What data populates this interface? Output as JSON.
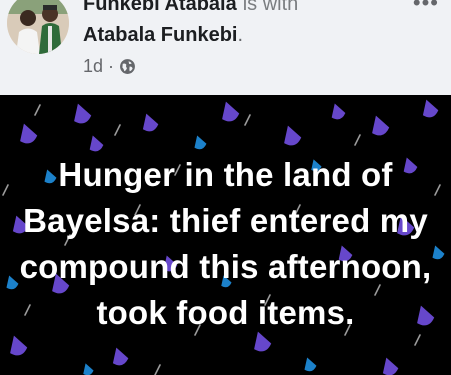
{
  "post_header": {
    "author": "Funkebi Atabala",
    "with_text": "is with",
    "tagged": "Atabala Funkebi",
    "tag_end": ".",
    "time": "1d",
    "separator": "·",
    "privacy_icon": "globe-icon",
    "more_icon": "more-options-icon",
    "more_glyph": "•••"
  },
  "post": {
    "text": "Hunger in the land of Bayelsa: thief entered my compound this afternoon, took food items.",
    "background_color": "#000000",
    "text_color": "#ffffff",
    "pattern": "purple-and-blue-raindrops"
  },
  "colors": {
    "drop_purple": "#6b4bd6",
    "drop_blue": "#1f8fe0",
    "streak": "#9a9a9a"
  }
}
